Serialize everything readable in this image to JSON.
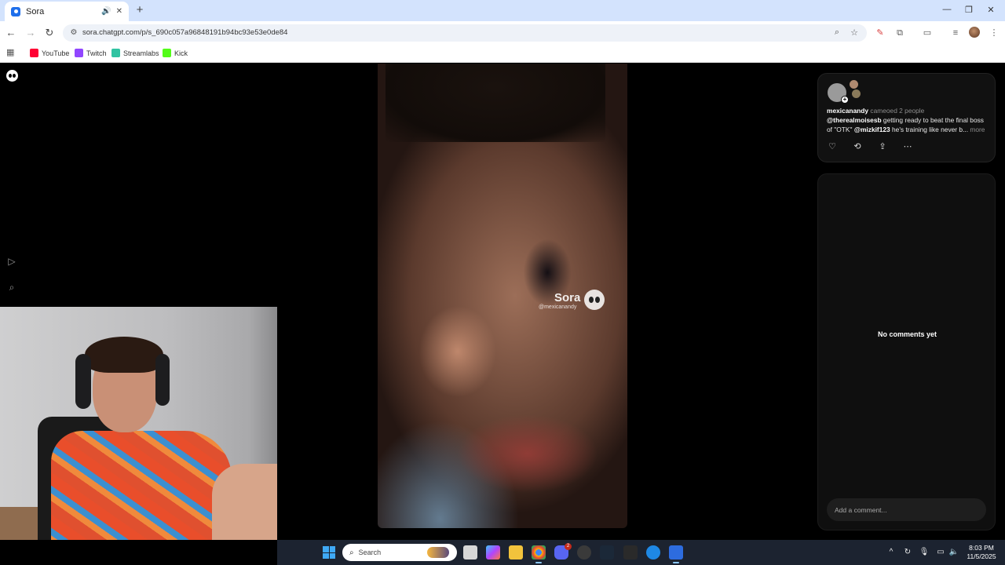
{
  "browser": {
    "tab": {
      "title": "Sora"
    },
    "url": "sora.chatgpt.com/p/s_690c057a96848191b94bc93e53e0de84",
    "bookmarks": [
      {
        "label": "YouTube",
        "color": "#ff0033"
      },
      {
        "label": "Twitch",
        "color": "#9146ff"
      },
      {
        "label": "Streamlabs",
        "color": "#31c3a2"
      },
      {
        "label": "Kick",
        "color": "#53fc18"
      }
    ]
  },
  "video": {
    "watermark_brand": "Sora",
    "watermark_user": "@mexicanandy"
  },
  "post": {
    "author": "mexicanandy",
    "cameo_text": "cameoed 2 people",
    "mention1": "@therealmoisesb",
    "text1": " getting ready to beat the final boss of \"OTK\" ",
    "mention2": "@mizkif123",
    "text2": " he's training like never b...",
    "more": "more"
  },
  "comments": {
    "empty_text": "No comments yet",
    "input_placeholder": "Add a comment..."
  },
  "taskbar": {
    "search_placeholder": "Search",
    "discord_badge": "2",
    "time": "8:03 PM",
    "date": "11/5/2025"
  }
}
